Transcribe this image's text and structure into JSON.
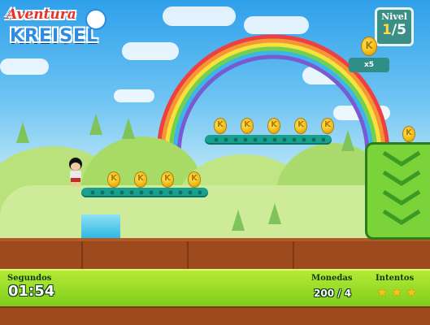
{
  "logo": {
    "line1": "Aventura",
    "line2": "KREISEL"
  },
  "level": {
    "label": "Nivel",
    "current": "1",
    "total": "/5"
  },
  "coin_multiplier": "x5",
  "coin_glyph": "K",
  "hud": {
    "time_label": "Segundos",
    "time_value": "01:54",
    "coins_label": "Monedas",
    "coins_value": "200 / 4",
    "tries_label": "Intentos",
    "tries_stars": 3
  },
  "colors": {
    "platform": "#1aa08e",
    "coin": "#f1b911",
    "hud": "#8fd820",
    "ground": "#9d4a1f",
    "block": "#7bd33a"
  }
}
